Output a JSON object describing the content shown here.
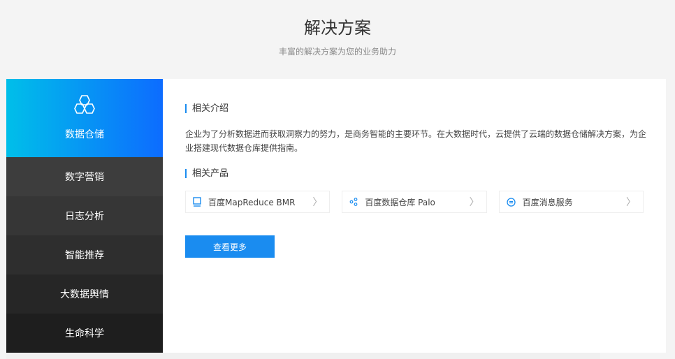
{
  "header": {
    "title": "解决方案",
    "subtitle": "丰富的解决方案为您的业务助力"
  },
  "sidebar": {
    "items": [
      {
        "label": "数据仓储",
        "icon": "hexagons-icon",
        "active": true
      },
      {
        "label": "数字营销"
      },
      {
        "label": "日志分析"
      },
      {
        "label": "智能推荐"
      },
      {
        "label": "大数据舆情"
      },
      {
        "label": "生命科学"
      }
    ]
  },
  "content": {
    "intro_heading": "相关介绍",
    "intro_text": "企业为了分析数据进而获取洞察力的努力，是商务智能的主要环节。在大数据时代，云提供了云端的数据仓储解决方案，为企业搭建现代数据仓库提供指南。",
    "products_heading": "相关产品",
    "products": [
      {
        "label": "百度MapReduce BMR",
        "icon": "server-icon"
      },
      {
        "label": "百度数据仓库 Palo",
        "icon": "share-nodes-icon"
      },
      {
        "label": "百度消息服务",
        "icon": "message-icon"
      }
    ],
    "more_label": "查看更多"
  },
  "colors": {
    "accent": "#1a8cf0"
  }
}
